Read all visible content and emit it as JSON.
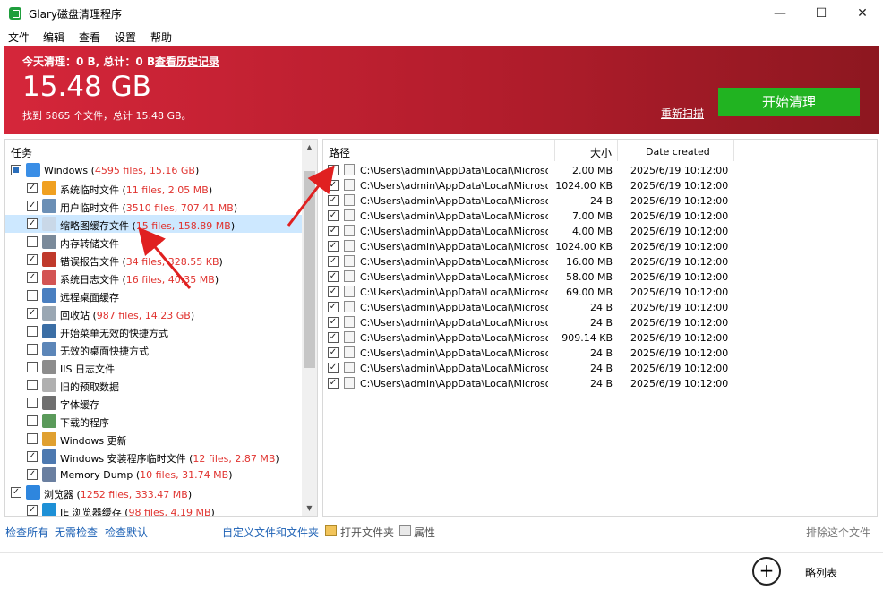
{
  "window": {
    "title": "Glary磁盘清理程序",
    "minimize": "—",
    "maximize": "☐",
    "close": "✕"
  },
  "menu": [
    "文件",
    "编辑",
    "查看",
    "设置",
    "帮助"
  ],
  "banner": {
    "today": "今天清理：0 B, 总计：0 B。",
    "history": "查看历史记录",
    "size": "15.48 GB",
    "found": "找到 5865 个文件，总计 15.48 GB。",
    "rescan": "重新扫描",
    "start": "开始清理"
  },
  "tasks": {
    "header": "任务",
    "rows": [
      {
        "name": "Windows",
        "count": "4595 files,",
        "size": "15.16 GB",
        "checked": "partial",
        "icon": "windows-icon",
        "level": 0
      },
      {
        "name": "系统临时文件",
        "count": "11 files,",
        "size": "2.05 MB",
        "checked": "yes",
        "icon": "windows-flag-icon",
        "level": 1
      },
      {
        "name": "用户临时文件",
        "count": "3510 files,",
        "size": "707.41 MB",
        "checked": "yes",
        "icon": "user-temp-icon",
        "level": 1
      },
      {
        "name": "缩略图缓存文件",
        "count": "15 files,",
        "size": "158.89 MB",
        "checked": "yes",
        "icon": "thumbnail-icon",
        "level": 1,
        "selected": true
      },
      {
        "name": "内存转储文件",
        "count": "",
        "size": "",
        "checked": "no",
        "icon": "memory-dump-icon",
        "level": 1
      },
      {
        "name": "错误报告文件",
        "count": "34 files,",
        "size": "328.55 KB",
        "checked": "yes",
        "icon": "error-report-icon",
        "level": 1
      },
      {
        "name": "系统日志文件",
        "count": "16 files,",
        "size": "40.35 MB",
        "checked": "yes",
        "icon": "system-log-icon",
        "level": 1
      },
      {
        "name": "远程桌面缓存",
        "count": "",
        "size": "",
        "checked": "no",
        "icon": "remote-desktop-icon",
        "level": 1
      },
      {
        "name": "回收站",
        "count": "987 files,",
        "size": "14.23 GB",
        "checked": "yes",
        "icon": "recycle-bin-icon",
        "level": 1
      },
      {
        "name": "开始菜单无效的快捷方式",
        "count": "",
        "size": "",
        "checked": "no",
        "icon": "start-menu-icon",
        "level": 1
      },
      {
        "name": "无效的桌面快捷方式",
        "count": "",
        "size": "",
        "checked": "no",
        "icon": "desktop-shortcut-icon",
        "level": 1
      },
      {
        "name": "IIS 日志文件",
        "count": "",
        "size": "",
        "checked": "no",
        "icon": "iis-log-icon",
        "level": 1
      },
      {
        "name": "旧的预取数据",
        "count": "",
        "size": "",
        "checked": "no",
        "icon": "prefetch-icon",
        "level": 1
      },
      {
        "name": "字体缓存",
        "count": "",
        "size": "",
        "checked": "no",
        "icon": "font-cache-icon",
        "level": 1
      },
      {
        "name": "下载的程序",
        "count": "",
        "size": "",
        "checked": "no",
        "icon": "downloaded-program-icon",
        "level": 1
      },
      {
        "name": "Windows 更新",
        "count": "",
        "size": "",
        "checked": "no",
        "icon": "windows-update-icon",
        "level": 1
      },
      {
        "name": "Windows 安装程序临时文件",
        "count": "12 files,",
        "size": "2.87 MB",
        "checked": "yes",
        "icon": "installer-temp-icon",
        "level": 1
      },
      {
        "name": "Memory Dump",
        "count": "10 files,",
        "size": "31.74 MB",
        "checked": "yes",
        "icon": "memory-dump-file-icon",
        "level": 1
      },
      {
        "name": "浏览器",
        "count": "1252 files,",
        "size": "333.47 MB",
        "checked": "yes",
        "icon": "browser-icon",
        "level": 0
      },
      {
        "name": "IE 浏览器缓存",
        "count": "98 files,",
        "size": "4.19 MB",
        "checked": "yes",
        "icon": "ie-icon",
        "level": 1
      }
    ]
  },
  "files": {
    "columns": {
      "path": "路径",
      "size": "大小",
      "date": "Date created"
    },
    "rows": [
      {
        "path": "C:\\Users\\admin\\AppData\\Local\\Microsoft...",
        "size": "2.00 MB",
        "date": "2025/6/19 10:12:00"
      },
      {
        "path": "C:\\Users\\admin\\AppData\\Local\\Microsoft...",
        "size": "1024.00 KB",
        "date": "2025/6/19 10:12:00"
      },
      {
        "path": "C:\\Users\\admin\\AppData\\Local\\Microsoft...",
        "size": "24 B",
        "date": "2025/6/19 10:12:00"
      },
      {
        "path": "C:\\Users\\admin\\AppData\\Local\\Microsoft...",
        "size": "7.00 MB",
        "date": "2025/6/19 10:12:00"
      },
      {
        "path": "C:\\Users\\admin\\AppData\\Local\\Microsoft...",
        "size": "4.00 MB",
        "date": "2025/6/19 10:12:00"
      },
      {
        "path": "C:\\Users\\admin\\AppData\\Local\\Microsoft...",
        "size": "1024.00 KB",
        "date": "2025/6/19 10:12:00"
      },
      {
        "path": "C:\\Users\\admin\\AppData\\Local\\Microsoft...",
        "size": "16.00 MB",
        "date": "2025/6/19 10:12:00"
      },
      {
        "path": "C:\\Users\\admin\\AppData\\Local\\Microsoft...",
        "size": "58.00 MB",
        "date": "2025/6/19 10:12:00"
      },
      {
        "path": "C:\\Users\\admin\\AppData\\Local\\Microsoft...",
        "size": "69.00 MB",
        "date": "2025/6/19 10:12:00"
      },
      {
        "path": "C:\\Users\\admin\\AppData\\Local\\Microsoft...",
        "size": "24 B",
        "date": "2025/6/19 10:12:00"
      },
      {
        "path": "C:\\Users\\admin\\AppData\\Local\\Microsoft...",
        "size": "24 B",
        "date": "2025/6/19 10:12:00"
      },
      {
        "path": "C:\\Users\\admin\\AppData\\Local\\Microsoft...",
        "size": "909.14 KB",
        "date": "2025/6/19 10:12:00"
      },
      {
        "path": "C:\\Users\\admin\\AppData\\Local\\Microsoft...",
        "size": "24 B",
        "date": "2025/6/19 10:12:00"
      },
      {
        "path": "C:\\Users\\admin\\AppData\\Local\\Microsoft...",
        "size": "24 B",
        "date": "2025/6/19 10:12:00"
      },
      {
        "path": "C:\\Users\\admin\\AppData\\Local\\Microsoft...",
        "size": "24 B",
        "date": "2025/6/19 10:12:00"
      }
    ]
  },
  "bottom": {
    "check_all": "检查所有",
    "check_none": "无需检查",
    "check_default": "检查默认",
    "custom": "自定义文件和文件夹",
    "open_folder": "打开文件夹",
    "properties": "属性",
    "exclude": "排除这个文件",
    "collapse": "略列表"
  },
  "colors": {
    "banner_start": "#d5263a",
    "banner_end": "#8d1720",
    "start_button": "#21b321",
    "highlight_text": "#e0332f",
    "link": "#1a5fb4",
    "selection": "#cde8ff"
  }
}
